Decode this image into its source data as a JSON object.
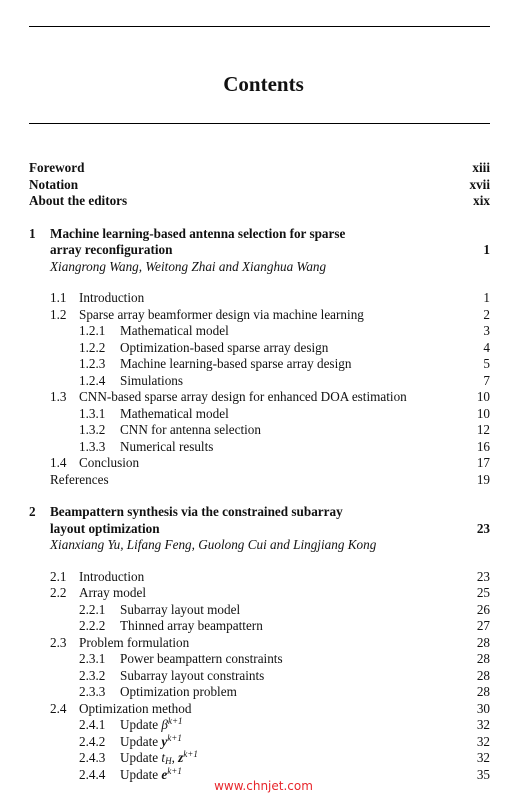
{
  "page": {
    "title": "Contents"
  },
  "front_matter": [
    {
      "label": "Foreword",
      "page": "xiii"
    },
    {
      "label": "Notation",
      "page": "xvii"
    },
    {
      "label": "About the editors",
      "page": "xix"
    }
  ],
  "chapters": [
    {
      "number": "1",
      "title_line1": "Machine learning-based antenna selection for sparse",
      "title_line2": "array reconfiguration",
      "page": "1",
      "authors": "Xiangrong Wang, Weitong Zhai and Xianghua Wang",
      "entries": [
        {
          "level": "sec",
          "number": "1.1",
          "label": "Introduction",
          "page": "1"
        },
        {
          "level": "sec",
          "number": "1.2",
          "label": "Sparse array beamformer design via machine learning",
          "page": "2"
        },
        {
          "level": "sub",
          "number": "1.2.1",
          "label": "Mathematical model",
          "page": "3"
        },
        {
          "level": "sub",
          "number": "1.2.2",
          "label": "Optimization-based sparse array design",
          "page": "4"
        },
        {
          "level": "sub",
          "number": "1.2.3",
          "label": "Machine learning-based sparse array design",
          "page": "5"
        },
        {
          "level": "sub",
          "number": "1.2.4",
          "label": "Simulations",
          "page": "7"
        },
        {
          "level": "sec",
          "number": "1.3",
          "label": "CNN-based sparse array design for enhanced DOA estimation",
          "page": "10"
        },
        {
          "level": "sub",
          "number": "1.3.1",
          "label": "Mathematical model",
          "page": "10"
        },
        {
          "level": "sub",
          "number": "1.3.2",
          "label": "CNN for antenna selection",
          "page": "12"
        },
        {
          "level": "sub",
          "number": "1.3.3",
          "label": "Numerical results",
          "page": "16"
        },
        {
          "level": "sec",
          "number": "1.4",
          "label": "Conclusion",
          "page": "17"
        }
      ],
      "references": {
        "label": "References",
        "page": "19"
      }
    },
    {
      "number": "2",
      "title_line1": "Beampattern synthesis via the constrained subarray",
      "title_line2": "layout optimization",
      "page": "23",
      "authors": "Xianxiang Yu, Lifang Feng, Guolong Cui and Lingjiang Kong",
      "entries": [
        {
          "level": "sec",
          "number": "2.1",
          "label": "Introduction",
          "page": "23"
        },
        {
          "level": "sec",
          "number": "2.2",
          "label": "Array model",
          "page": "25"
        },
        {
          "level": "sub",
          "number": "2.2.1",
          "label": "Subarray layout model",
          "page": "26"
        },
        {
          "level": "sub",
          "number": "2.2.2",
          "label": "Thinned array beampattern",
          "page": "27"
        },
        {
          "level": "sec",
          "number": "2.3",
          "label": "Problem formulation",
          "page": "28"
        },
        {
          "level": "sub",
          "number": "2.3.1",
          "label": "Power beampattern constraints",
          "page": "28"
        },
        {
          "level": "sub",
          "number": "2.3.2",
          "label": "Subarray layout constraints",
          "page": "28"
        },
        {
          "level": "sub",
          "number": "2.3.3",
          "label": "Optimization problem",
          "page": "28"
        },
        {
          "level": "sec",
          "number": "2.4",
          "label": "Optimization method",
          "page": "30"
        },
        {
          "level": "sub",
          "number": "2.4.1",
          "label_prefix": "Update ",
          "math_base": "β",
          "math_sup": "k+1",
          "page": "32"
        },
        {
          "level": "sub",
          "number": "2.4.2",
          "label_prefix": "Update ",
          "math_base": "y",
          "math_sup": "k+1",
          "page": "32"
        },
        {
          "level": "sub",
          "number": "2.4.3",
          "label_prefix": "Update ",
          "math_t": "t",
          "math_t_sub": "H",
          "math_sep": ", ",
          "math_base": "z",
          "math_sup": "k+1",
          "page": "32"
        },
        {
          "level": "sub",
          "number": "2.4.4",
          "label_prefix": "Update ",
          "math_base": "e",
          "math_sup": "k+1",
          "page": "35"
        }
      ]
    }
  ],
  "watermark": {
    "text": "www.chnjet.com",
    "color": "#e8262c"
  }
}
